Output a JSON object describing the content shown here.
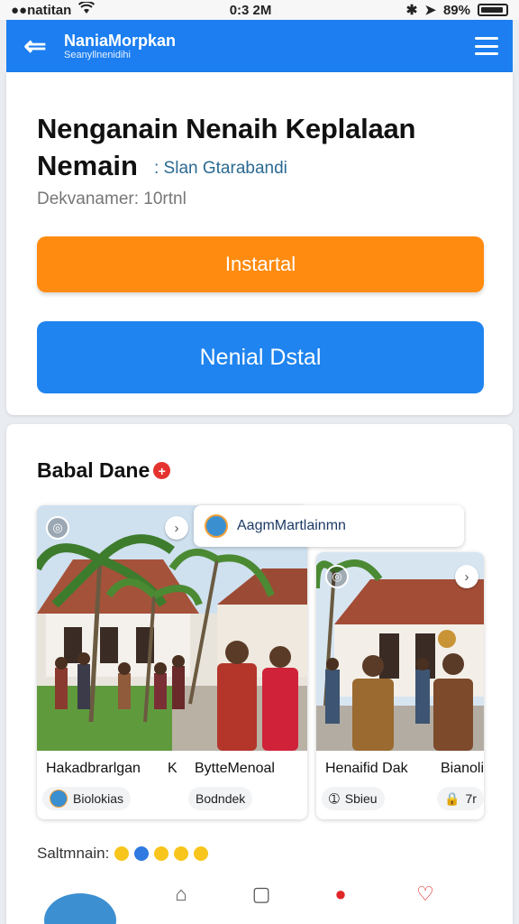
{
  "status_bar": {
    "carrier": "●●natitan",
    "time": "0:3 2M",
    "battery": "89%"
  },
  "app_bar": {
    "title": "NaniaMorpkan",
    "subtitle": "Seanyllnenidihi",
    "back_icon": "back-arrow-icon",
    "menu_icon": "hamburger-menu-icon"
  },
  "header_card": {
    "title_line1": "Nenganain Nenaih Keplalaan",
    "title_line2": "Nemain",
    "title_tag": ": Slan Gtarabandi",
    "meta": "Dekvanamer: 10rtnl",
    "primary_button": "Instartal",
    "secondary_button": "Nenial Dstal",
    "colors": {
      "primary": "#ff8b10",
      "secondary": "#1f84ef",
      "appbar": "#1c7ef0"
    }
  },
  "section": {
    "title": "Babal Dane",
    "badge": "+",
    "popup": {
      "label": "AagmMartlainmn"
    },
    "tiles": [
      {
        "caption_left": "Hakadbrarlgan",
        "caption_mid": "K",
        "caption_right": "BytteMenoal",
        "chip_left": "Biolokias",
        "chip_right": "Bodndek"
      },
      {
        "caption_left": "Henaifid Dak",
        "caption_right": "Bianoli",
        "chip_left": "Sbieu",
        "chip_right": "7r"
      }
    ],
    "reactions_label": "Saltmnain:"
  },
  "bottom_nav": {
    "items": [
      "home-icon",
      "document-icon",
      "notification-icon",
      "favorite-icon"
    ]
  }
}
